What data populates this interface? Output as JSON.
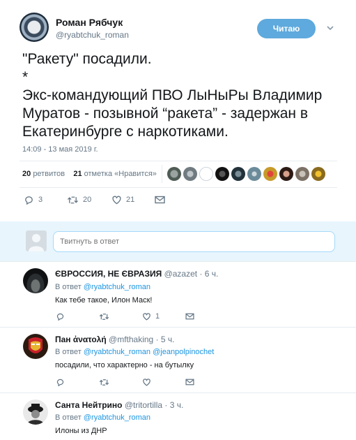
{
  "author": {
    "name": "Роман Рябчук",
    "handle": "@ryabtchuk_roman"
  },
  "follow_button": "Читаю",
  "tweet": {
    "text": "\"Ракету\" посадили.\n*\nЭкс-командующий ПВО ЛыНыРы Владимир Муратов  - позывной “ракета” - задержан в Екатеринбурге с наркотиками.",
    "timestamp": "14:09 - 13 мая 2019 г."
  },
  "stats": {
    "retweets_count": "20",
    "retweets_label": "ретвитов",
    "likes_count": "21",
    "likes_label": "отметка «Нравится»"
  },
  "actions": {
    "replies": "3",
    "retweets": "20",
    "likes": "21"
  },
  "reply_box": {
    "placeholder": "Твитнуть в ответ"
  },
  "replies": [
    {
      "name": "ЄВРОССИЯ, НЕ ЄВРАЗИЯ",
      "handle": "@azazet",
      "time": "· 6 ч.",
      "in_reply_prefix": "В ответ",
      "in_reply_to": "@ryabtchuk_roman",
      "in_reply_to_2": "",
      "text": "Как тебе такое, Илон Маск!",
      "likes": "1"
    },
    {
      "name": "Пан ἀνατολή",
      "handle": "@mfthaking",
      "time": "· 5 ч.",
      "in_reply_prefix": "В ответ",
      "in_reply_to": "@ryabtchuk_roman",
      "in_reply_to_2": "@jeanpolpinochet",
      "text": "посадили, что характерно - на бутылку",
      "likes": ""
    },
    {
      "name": "Санта Нейтрино",
      "handle": "@tritortilla",
      "time": "· 3 ч.",
      "in_reply_prefix": "В ответ",
      "in_reply_to": "@ryabtchuk_roman",
      "in_reply_to_2": "",
      "text": "Илоны из ДНР",
      "likes": ""
    }
  ],
  "colors": {
    "accent": "#1b95e0",
    "follow_bg": "#5ea9dd",
    "muted": "#657786",
    "reply_area_bg": "#e8f5fd"
  }
}
